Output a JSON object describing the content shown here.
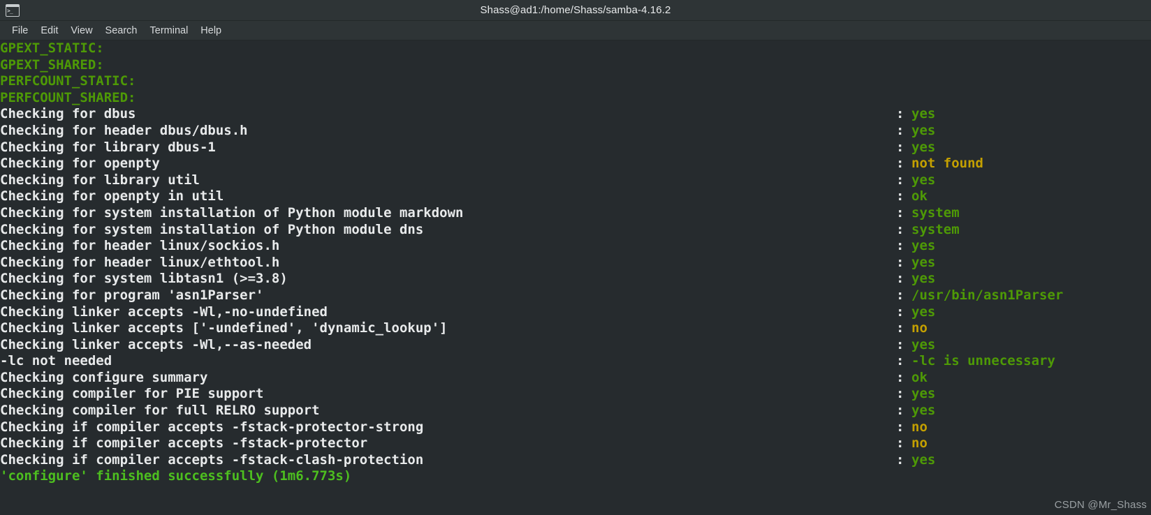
{
  "window": {
    "title": "Shass@ad1:/home/Shass/samba-4.16.2",
    "icon": "terminal-icon"
  },
  "menubar": {
    "items": [
      {
        "label": "File"
      },
      {
        "label": "Edit"
      },
      {
        "label": "View"
      },
      {
        "label": "Search"
      },
      {
        "label": "Terminal"
      },
      {
        "label": "Help"
      }
    ]
  },
  "colors": {
    "background": "#262B2E",
    "chrome": "#2E3436",
    "foreground": "#e8eaeb",
    "green": "#4E9A06",
    "bright_green": "#4DBF1F",
    "amber": "#C4A000"
  },
  "terminal": {
    "separator": ":",
    "lines": [
      {
        "label": "GPEXT_STATIC:",
        "label_color": "green",
        "value": "",
        "value_color": "green",
        "has_sep": false
      },
      {
        "label": "GPEXT_SHARED:",
        "label_color": "green",
        "value": "",
        "value_color": "green",
        "has_sep": false
      },
      {
        "label": "PERFCOUNT_STATIC:",
        "label_color": "green",
        "value": "",
        "value_color": "green",
        "has_sep": false
      },
      {
        "label": "PERFCOUNT_SHARED:",
        "label_color": "green",
        "value": "",
        "value_color": "green",
        "has_sep": false
      },
      {
        "label": "Checking for dbus",
        "label_color": "white",
        "value": "yes",
        "value_color": "green",
        "has_sep": true
      },
      {
        "label": "Checking for header dbus/dbus.h",
        "label_color": "white",
        "value": "yes",
        "value_color": "green",
        "has_sep": true
      },
      {
        "label": "Checking for library dbus-1",
        "label_color": "white",
        "value": "yes",
        "value_color": "green",
        "has_sep": true
      },
      {
        "label": "Checking for openpty",
        "label_color": "white",
        "value": "not found",
        "value_color": "amber",
        "has_sep": true
      },
      {
        "label": "Checking for library util",
        "label_color": "white",
        "value": "yes",
        "value_color": "green",
        "has_sep": true
      },
      {
        "label": "Checking for openpty in util",
        "label_color": "white",
        "value": "ok",
        "value_color": "green",
        "has_sep": true
      },
      {
        "label": "Checking for system installation of Python module markdown",
        "label_color": "white",
        "value": "system",
        "value_color": "green",
        "has_sep": true
      },
      {
        "label": "Checking for system installation of Python module dns",
        "label_color": "white",
        "value": "system",
        "value_color": "green",
        "has_sep": true
      },
      {
        "label": "Checking for header linux/sockios.h",
        "label_color": "white",
        "value": "yes",
        "value_color": "green",
        "has_sep": true
      },
      {
        "label": "Checking for header linux/ethtool.h",
        "label_color": "white",
        "value": "yes",
        "value_color": "green",
        "has_sep": true
      },
      {
        "label": "Checking for system libtasn1 (>=3.8)",
        "label_color": "white",
        "value": "yes",
        "value_color": "green",
        "has_sep": true
      },
      {
        "label": "Checking for program 'asn1Parser'",
        "label_color": "white",
        "value": "/usr/bin/asn1Parser",
        "value_color": "green",
        "has_sep": true
      },
      {
        "label": "Checking linker accepts -Wl,-no-undefined",
        "label_color": "white",
        "value": "yes",
        "value_color": "green",
        "has_sep": true
      },
      {
        "label": "Checking linker accepts ['-undefined', 'dynamic_lookup']",
        "label_color": "white",
        "value": "no",
        "value_color": "amber",
        "has_sep": true
      },
      {
        "label": "Checking linker accepts -Wl,--as-needed",
        "label_color": "white",
        "value": "yes",
        "value_color": "green",
        "has_sep": true
      },
      {
        "label": "-lc not needed",
        "label_color": "white",
        "value": "-lc is unnecessary",
        "value_color": "green",
        "has_sep": true
      },
      {
        "label": "Checking configure summary",
        "label_color": "white",
        "value": "ok",
        "value_color": "green",
        "has_sep": true
      },
      {
        "label": "Checking compiler for PIE support",
        "label_color": "white",
        "value": "yes",
        "value_color": "green",
        "has_sep": true
      },
      {
        "label": "Checking compiler for full RELRO support",
        "label_color": "white",
        "value": "yes",
        "value_color": "green",
        "has_sep": true
      },
      {
        "label": "Checking if compiler accepts -fstack-protector-strong",
        "label_color": "white",
        "value": "no",
        "value_color": "amber",
        "has_sep": true
      },
      {
        "label": "Checking if compiler accepts -fstack-protector",
        "label_color": "white",
        "value": "no",
        "value_color": "amber",
        "has_sep": true
      },
      {
        "label": "Checking if compiler accepts -fstack-clash-protection",
        "label_color": "white",
        "value": "yes",
        "value_color": "green",
        "has_sep": true
      },
      {
        "label": "'configure' finished successfully (1m6.773s)",
        "label_color": "bgreen",
        "value": "",
        "value_color": "bgreen",
        "has_sep": false
      }
    ]
  },
  "watermark": {
    "text": "CSDN @Mr_Shass"
  }
}
